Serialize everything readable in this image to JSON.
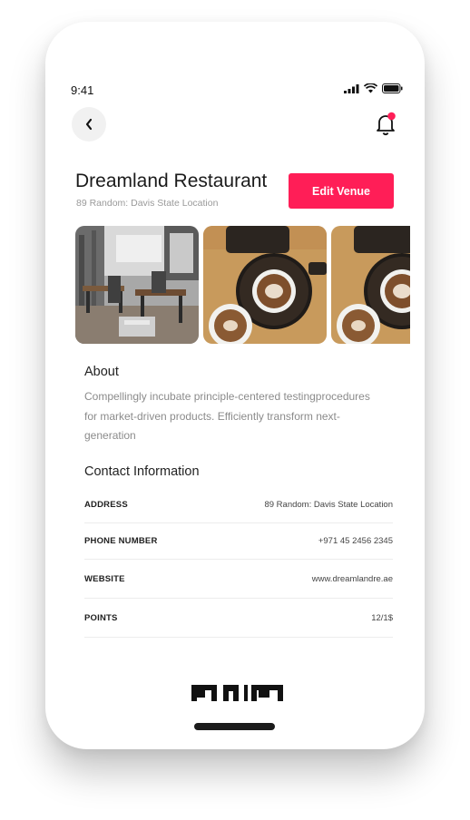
{
  "status_bar": {
    "time": "9:41"
  },
  "venue": {
    "title": "Dreamland Restaurant",
    "subtitle": "89 Random: Davis State Location",
    "edit_label": "Edit Venue"
  },
  "gallery": [
    {
      "name": "restaurant-interior-photo"
    },
    {
      "name": "coffee-cups-photo"
    },
    {
      "name": "coffee-cups-photo"
    }
  ],
  "about": {
    "heading": "About",
    "lines": [
      "Compellingly incubate principle-centered testingprocedures",
      "for market-driven products. Efficiently transform next-",
      "generation"
    ]
  },
  "contact": {
    "heading": "Contact Information",
    "rows": [
      {
        "key": "ADDRESS",
        "value": "89 Random: Davis State Location"
      },
      {
        "key": "PHONE NUMBER",
        "value": "+971 45 2456 2345"
      },
      {
        "key": "WEBSITE",
        "value": "www.dreamlandre.ae"
      },
      {
        "key": "POINTS",
        "value": "12/1$"
      }
    ]
  },
  "colors": {
    "accent": "#ff1e57",
    "notification_dot": "#ff1e57"
  },
  "icons": [
    "chevron-left-icon",
    "bell-icon",
    "signal-icon",
    "wifi-icon",
    "battery-icon"
  ]
}
